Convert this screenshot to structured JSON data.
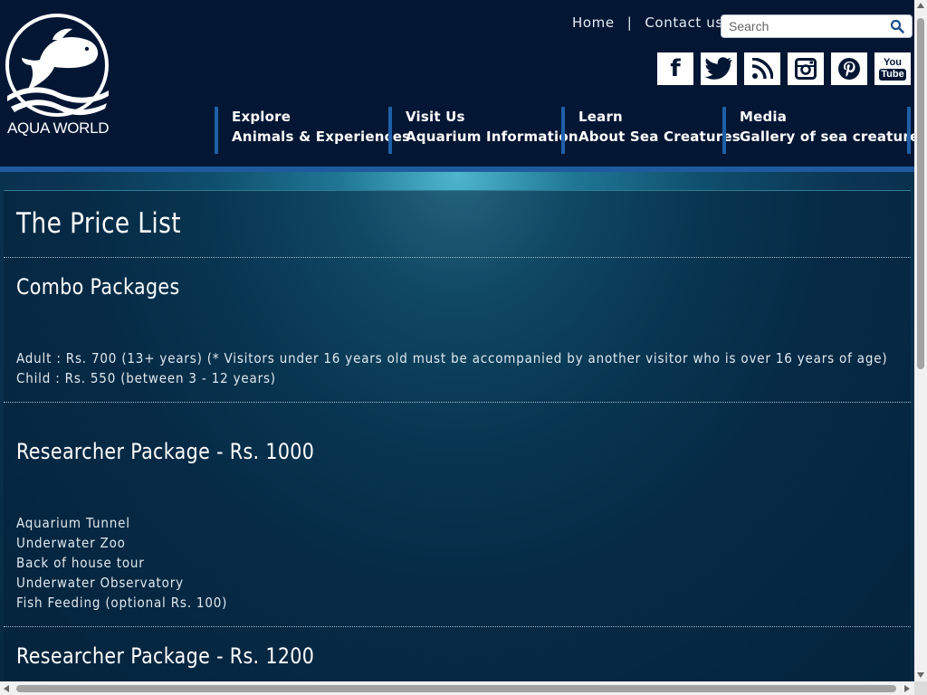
{
  "brand": {
    "name": "AQUA WORLD"
  },
  "toplinks": {
    "home": "Home",
    "separator": "|",
    "contact": "Contact us"
  },
  "search": {
    "placeholder": "Search"
  },
  "social": [
    {
      "icon": "facebook-icon",
      "glyph": "f"
    },
    {
      "icon": "twitter-icon"
    },
    {
      "icon": "rss-icon"
    },
    {
      "icon": "instagram-icon"
    },
    {
      "icon": "pinterest-icon"
    },
    {
      "icon": "youtube-icon",
      "glyph_top": "You",
      "glyph_bottom": "Tube"
    }
  ],
  "nav": [
    {
      "title": "Explore",
      "subtitle": "Animals & Experiences"
    },
    {
      "title": "Visit Us",
      "subtitle": "Aquarium Information"
    },
    {
      "title": "Learn",
      "subtitle": "About Sea Creatures"
    },
    {
      "title": "Media",
      "subtitle": "Gallery of sea creatures"
    }
  ],
  "page": {
    "title": "The Price List",
    "sections": [
      {
        "heading": "Combo Packages",
        "lines": [
          "Adult : Rs. 700 (13+ years) (* Visitors under 16 years old must be accompanied by another visitor who is over 16 years of age)",
          "Child : Rs. 550 (between 3 - 12 years)"
        ]
      },
      {
        "heading": "Researcher Package - Rs. 1000",
        "lines": [
          "Aquarium Tunnel",
          "Underwater Zoo",
          "Back of house tour",
          "Underwater Observatory",
          "Fish Feeding (optional Rs. 100)"
        ]
      },
      {
        "heading": "Researcher Package - Rs. 1200",
        "lines": []
      }
    ]
  },
  "colors": {
    "header_bg": "#031734",
    "nav_accent": "#1e5fa8",
    "text": "#ffffff"
  }
}
